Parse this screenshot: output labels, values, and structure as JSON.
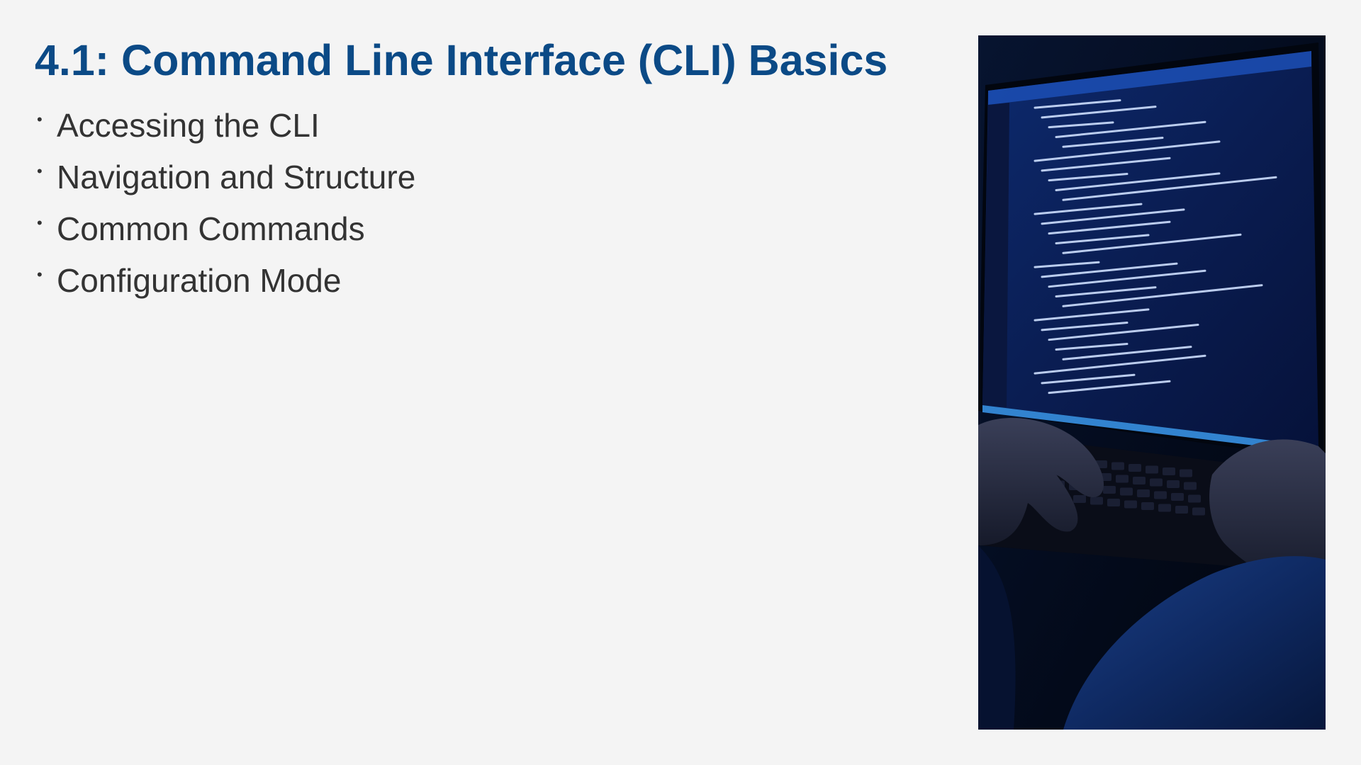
{
  "slide": {
    "title": "4.1: Command Line Interface (CLI) Basics",
    "bullets": [
      "Accessing the CLI",
      "Navigation and Structure",
      "Common Commands",
      "Configuration Mode"
    ],
    "bullet_glyph": "•"
  },
  "photo": {
    "subject": "hands-typing-on-laptop-with-code-screen",
    "colors": {
      "screen": "#0b1f57",
      "code_text": "#cfe0ff",
      "background": "#030812"
    }
  }
}
